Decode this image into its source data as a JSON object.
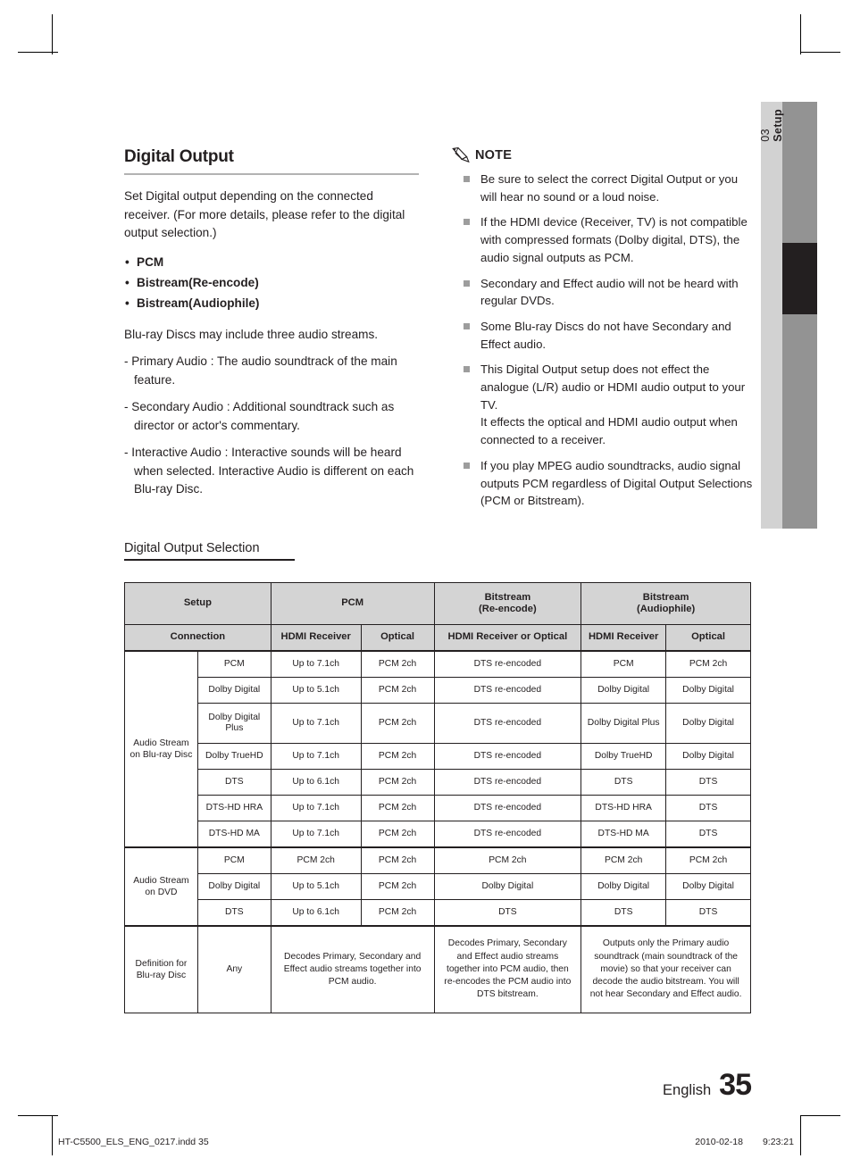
{
  "side_tab": {
    "number": "03",
    "label": "Setup"
  },
  "left_column": {
    "title": "Digital Output",
    "intro": "Set Digital output depending on the connected receiver. (For more details, please refer to the digital output selection.)",
    "options": [
      "PCM",
      "Bistream(Re-encode)",
      "Bistream(Audiophile)"
    ],
    "streams_intro": "Blu-ray Discs may include three audio streams.",
    "stream_items": [
      "- Primary Audio : The audio soundtrack of the main feature.",
      "- Secondary Audio : Additional soundtrack such as director or actor's commentary.",
      "- Interactive Audio : Interactive sounds will be heard when selected. Interactive Audio is different on each Blu-ray Disc."
    ]
  },
  "note": {
    "label": "NOTE",
    "icon": "pencil-icon",
    "items": [
      "Be sure to select the correct Digital Output or you will hear no sound or a loud noise.",
      "If the HDMI device (Receiver, TV) is not compatible with compressed formats (Dolby digital, DTS), the audio signal outputs as PCM.",
      "Secondary and Effect audio will not be heard with regular DVDs.",
      "Some Blu-ray Discs do not have Secondary and Effect audio.",
      "This Digital Output setup does not effect the analogue (L/R) audio or HDMI audio output to your TV.\nIt effects the optical and HDMI audio output when connected to a receiver.",
      "If you play MPEG audio soundtracks, audio signal outputs PCM regardless of Digital Output Selections (PCM or Bitstream)."
    ]
  },
  "subsection": {
    "title": "Digital Output Selection"
  },
  "table": {
    "header_groups": [
      {
        "label": "Setup",
        "colspan": 2
      },
      {
        "label": "PCM",
        "colspan": 2
      },
      {
        "label": "Bitstream\n(Re-encode)",
        "colspan": 1
      },
      {
        "label": "Bitstream\n(Audiophile)",
        "colspan": 2
      }
    ],
    "header_connection": [
      "Connection",
      "HDMI Receiver",
      "Optical",
      "HDMI Receiver or Optical",
      "HDMI Receiver",
      "Optical"
    ],
    "group_bluray_label": "Audio Stream\non Blu-ray Disc",
    "group_dvd_label": "Audio Stream\non DVD",
    "group_def_label": "Definition for\nBlu-ray Disc",
    "bluray_rows": [
      [
        "PCM",
        "Up to 7.1ch",
        "PCM 2ch",
        "DTS re-encoded",
        "PCM",
        "PCM 2ch"
      ],
      [
        "Dolby Digital",
        "Up to 5.1ch",
        "PCM 2ch",
        "DTS re-encoded",
        "Dolby Digital",
        "Dolby Digital"
      ],
      [
        "Dolby Digital\nPlus",
        "Up to 7.1ch",
        "PCM 2ch",
        "DTS re-encoded",
        "Dolby Digital Plus",
        "Dolby Digital"
      ],
      [
        "Dolby TrueHD",
        "Up to 7.1ch",
        "PCM 2ch",
        "DTS re-encoded",
        "Dolby TrueHD",
        "Dolby Digital"
      ],
      [
        "DTS",
        "Up to 6.1ch",
        "PCM 2ch",
        "DTS re-encoded",
        "DTS",
        "DTS"
      ],
      [
        "DTS-HD HRA",
        "Up to 7.1ch",
        "PCM 2ch",
        "DTS re-encoded",
        "DTS-HD HRA",
        "DTS"
      ],
      [
        "DTS-HD MA",
        "Up to 7.1ch",
        "PCM 2ch",
        "DTS re-encoded",
        "DTS-HD MA",
        "DTS"
      ]
    ],
    "dvd_rows": [
      [
        "PCM",
        "PCM 2ch",
        "PCM 2ch",
        "PCM 2ch",
        "PCM 2ch",
        "PCM 2ch"
      ],
      [
        "Dolby Digital",
        "Up to 5.1ch",
        "PCM 2ch",
        "Dolby Digital",
        "Dolby Digital",
        "Dolby Digital"
      ],
      [
        "DTS",
        "Up to 6.1ch",
        "PCM 2ch",
        "DTS",
        "DTS",
        "DTS"
      ]
    ],
    "definition_row": {
      "any": "Any",
      "pcm": "Decodes Primary, Secondary and Effect audio streams together into PCM audio.",
      "reencode": "Decodes Primary, Secondary and Effect audio streams together into PCM audio, then re-encodes the PCM audio into DTS bitstream.",
      "audiophile": "Outputs only the Primary audio soundtrack (main soundtrack of the movie) so that your receiver can decode the audio bitstream. You will not hear Secondary and Effect audio."
    }
  },
  "footer": {
    "language": "English",
    "page_number": "35",
    "file_name": "HT-C5500_ELS_ENG_0217.indd   35",
    "date": "2010-02-18",
    "time": "9:23:21"
  }
}
